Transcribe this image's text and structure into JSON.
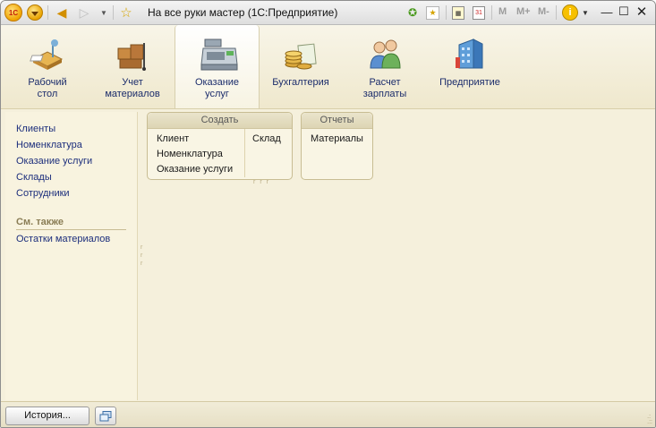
{
  "window": {
    "title": "На все руки мастер  (1С:Предприятие)",
    "logo_text": "1С"
  },
  "toolbar": {
    "back_icon": "arrow-left-icon",
    "forward_icon": "arrow-right-icon",
    "favorites_icon": "star-icon",
    "m_label": "M",
    "m_plus_label": "M+",
    "m_minus_label": "M-",
    "calendar_day": "31"
  },
  "sections": [
    {
      "label": "Рабочий\nстол",
      "icon": "desktop-icon"
    },
    {
      "label": "Учет\nматериалов",
      "icon": "materials-icon"
    },
    {
      "label": "Оказание\nуслуг",
      "icon": "cash-register-icon"
    },
    {
      "label": "Бухгалтерия",
      "icon": "accounting-icon"
    },
    {
      "label": "Расчет\nзарплаты",
      "icon": "salary-icon"
    },
    {
      "label": "Предприятие",
      "icon": "enterprise-icon"
    }
  ],
  "nav": {
    "items": [
      "Клиенты",
      "Номенклатура",
      "Оказание услуги",
      "Склады",
      "Сотрудники"
    ],
    "see_also_title": "См. также",
    "see_also_items": [
      "Остатки материалов"
    ]
  },
  "groups": {
    "create": {
      "title": "Создать",
      "col1": [
        "Клиент",
        "Номенклатура",
        "Оказание услуги"
      ],
      "col2": [
        "Склад"
      ]
    },
    "reports": {
      "title": "Отчеты",
      "items": [
        "Материалы"
      ]
    }
  },
  "bottom": {
    "history_label": "История..."
  },
  "colors": {
    "background": "#f5f0dc",
    "link": "#1c2e7c",
    "accent": "#f0a400"
  }
}
